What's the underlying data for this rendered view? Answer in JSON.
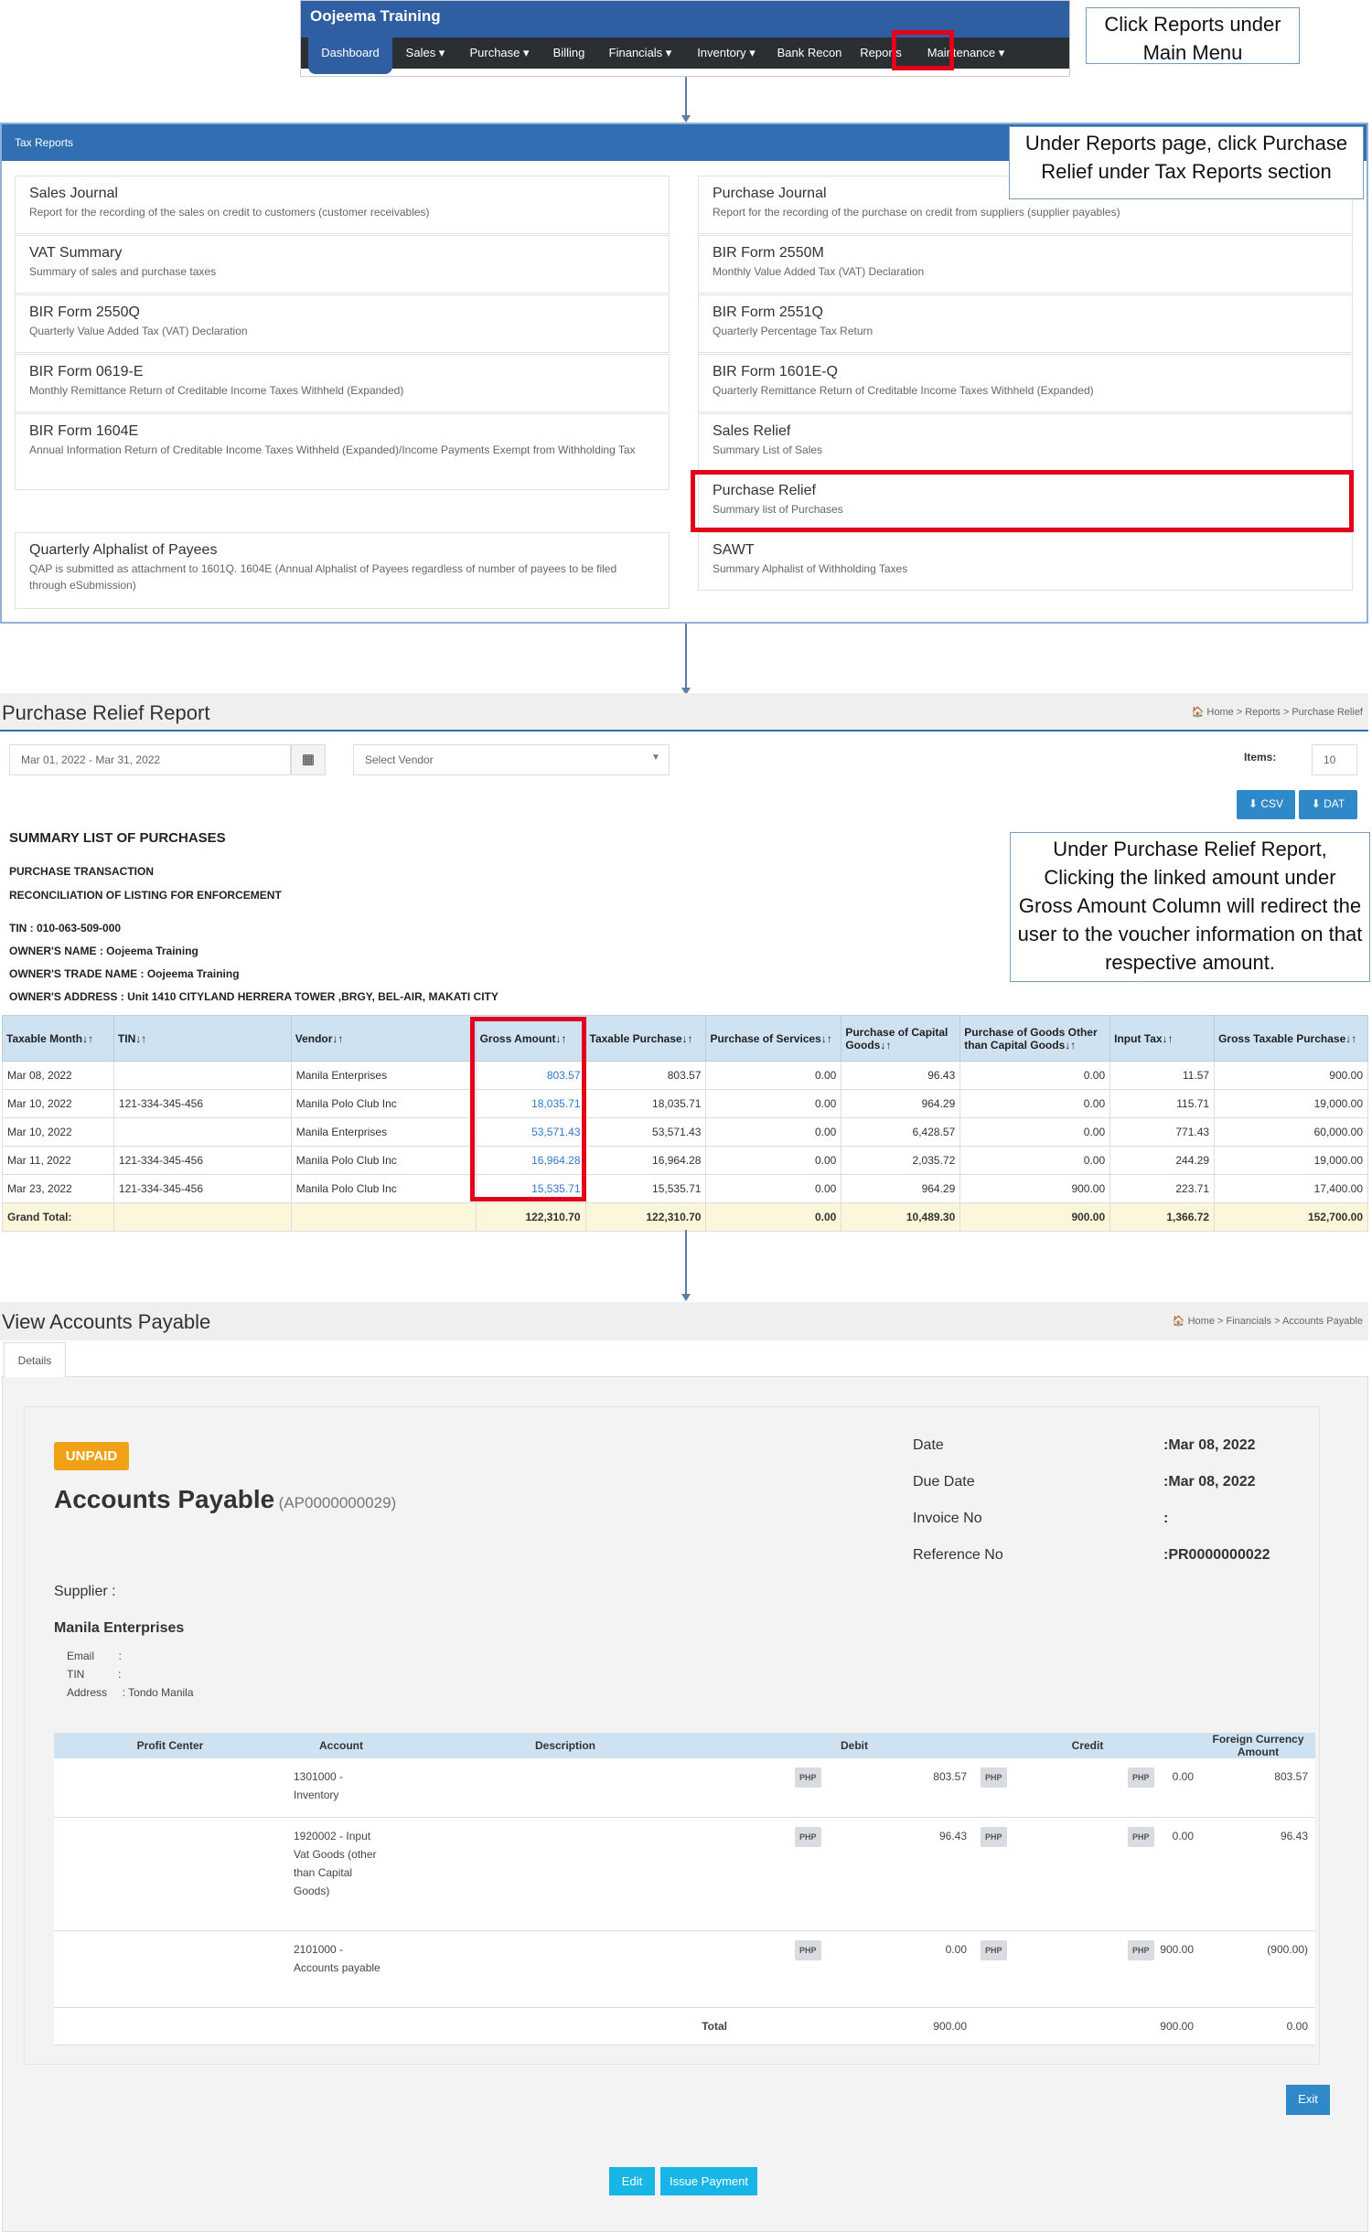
{
  "navbar": {
    "title": "Oojeema Training",
    "items": [
      "Dashboard",
      "Sales ▾",
      "Purchase ▾",
      "Billing",
      "Financials ▾",
      "Inventory ▾",
      "Bank Recon",
      "Reports",
      "Maintenance ▾"
    ]
  },
  "callouts": {
    "reports": "Click Reports under Main Menu",
    "purchase_relief": "Under Reports page, click Purchase Relief under Tax Reports section",
    "gross_amount": "Under Purchase Relief Report, Clicking the linked amount under Gross Amount Column will redirect the user to the voucher information on that respective amount."
  },
  "tax_reports": {
    "heading": "Tax Reports",
    "left": [
      {
        "title": "Sales Journal",
        "desc": "Report for the recording of the sales on credit to customers (customer receivables)"
      },
      {
        "title": "VAT Summary",
        "desc": "Summary of sales and purchase taxes"
      },
      {
        "title": "BIR Form 2550Q",
        "desc": "Quarterly Value Added Tax (VAT) Declaration"
      },
      {
        "title": "BIR Form 0619-E",
        "desc": "Monthly Remittance Return of Creditable Income Taxes Withheld (Expanded)"
      },
      {
        "title": "BIR Form 1604E",
        "desc": "Annual Information Return of Creditable Income Taxes Withheld (Expanded)/Income Payments Exempt from Withholding Tax"
      },
      {
        "title": "Quarterly Alphalist of Payees",
        "desc": "QAP is submitted as attachment to 1601Q. 1604E (Annual Alphalist of Payees regardless of number of payees to be filed through eSubmission)"
      }
    ],
    "right": [
      {
        "title": "Purchase Journal",
        "desc": "Report for the recording of the purchase on credit from suppliers (supplier payables)"
      },
      {
        "title": "BIR Form 2550M",
        "desc": "Monthly Value Added Tax (VAT) Declaration"
      },
      {
        "title": "BIR Form 2551Q",
        "desc": "Quarterly Percentage Tax Return"
      },
      {
        "title": "BIR Form 1601E-Q",
        "desc": "Quarterly Remittance Return of Creditable Income Taxes Withheld (Expanded)"
      },
      {
        "title": "Sales Relief",
        "desc": "Summary List of Sales"
      },
      {
        "title": "Purchase Relief",
        "desc": "Summary list of Purchases"
      },
      {
        "title": "SAWT",
        "desc": "Summary Alphalist of Withholding Taxes"
      }
    ]
  },
  "purchase_relief": {
    "title": "Purchase Relief Report",
    "breadcrumb": "🏠 Home  >  Reports  >  Purchase Relief",
    "date_range": "Mar 01, 2022 - Mar 31, 2022",
    "vendor_placeholder": "Select Vendor",
    "items_label": "Items:",
    "items_value": "10",
    "csv": "CSV",
    "dat": "DAT",
    "summary_title": "SUMMARY LIST OF PURCHASES",
    "purchase_transaction": "PURCHASE TRANSACTION",
    "reconciliation": "RECONCILIATION OF LISTING FOR ENFORCEMENT",
    "tin": "TIN : 010-063-509-000",
    "owner_name": "OWNER'S NAME : Oojeema Training",
    "trade_name": "OWNER'S TRADE NAME : Oojeema Training",
    "address": "OWNER'S ADDRESS : Unit 1410 CITYLAND HERRERA TOWER ,BRGY, BEL-AIR, MAKATI CITY",
    "columns": [
      "Taxable Month↓↑",
      "TIN↓↑",
      "Vendor↓↑",
      "Gross Amount↓↑",
      "Taxable Purchase↓↑",
      "Purchase of Services↓↑",
      "Purchase of Capital Goods↓↑",
      "Purchase of Goods Other than Capital Goods↓↑",
      "Input Tax↓↑",
      "Gross Taxable Purchase↓↑"
    ],
    "rows": [
      [
        "Mar 08, 2022",
        "",
        "Manila Enterprises",
        "803.57",
        "803.57",
        "0.00",
        "96.43",
        "0.00",
        "11.57",
        "900.00"
      ],
      [
        "Mar 10, 2022",
        "121-334-345-456",
        "Manila Polo Club Inc",
        "18,035.71",
        "18,035.71",
        "0.00",
        "964.29",
        "0.00",
        "115.71",
        "19,000.00"
      ],
      [
        "Mar 10, 2022",
        "",
        "Manila Enterprises",
        "53,571.43",
        "53,571.43",
        "0.00",
        "6,428.57",
        "0.00",
        "771.43",
        "60,000.00"
      ],
      [
        "Mar 11, 2022",
        "121-334-345-456",
        "Manila Polo Club Inc",
        "16,964.28",
        "16,964.28",
        "0.00",
        "2,035.72",
        "0.00",
        "244.29",
        "19,000.00"
      ],
      [
        "Mar 23, 2022",
        "121-334-345-456",
        "Manila Polo Club Inc",
        "15,535.71",
        "15,535.71",
        "0.00",
        "964.29",
        "900.00",
        "223.71",
        "17,400.00"
      ]
    ],
    "total": [
      "Grand Total:",
      "",
      "",
      "122,310.70",
      "122,310.70",
      "0.00",
      "10,489.30",
      "900.00",
      "1,366.72",
      "152,700.00"
    ]
  },
  "accounts_payable": {
    "title": "View Accounts Payable",
    "breadcrumb": "🏠 Home  >  Financials  >  Accounts Payable",
    "tab": "Details",
    "status": "UNPAID",
    "heading": "Accounts Payable",
    "ap_no": "(AP0000000029)",
    "date_label": "Date",
    "date_value": ":Mar 08, 2022",
    "due_label": "Due Date",
    "due_value": ":Mar 08, 2022",
    "invoice_label": "Invoice No",
    "invoice_value": ":",
    "ref_label": "Reference No",
    "ref_value": ":PR0000000022",
    "supplier_label": "Supplier :",
    "supplier_name": "Manila Enterprises",
    "email": "Email        :",
    "tin": "TIN           :",
    "address": "Address     : Tondo Manila",
    "columns": [
      "Profit Center",
      "Account",
      "Description",
      "Debit",
      "Credit",
      "Foreign Currency Amount"
    ],
    "currency": "PHP",
    "lines": [
      {
        "account": "1301000 - Inventory",
        "debit": "803.57",
        "credit": "0.00",
        "foreign": "803.57"
      },
      {
        "account": "1920002 - Input Vat Goods (other than Capital Goods)",
        "debit": "96.43",
        "credit": "0.00",
        "foreign": "96.43"
      },
      {
        "account": "2101000 - Accounts payable",
        "debit": "0.00",
        "credit": "900.00",
        "foreign": "(900.00)"
      }
    ],
    "total_label": "Total",
    "total_debit": "900.00",
    "total_credit": "900.00",
    "total_foreign": "0.00",
    "exit": "Exit",
    "edit": "Edit",
    "issue_payment": "Issue Payment"
  }
}
